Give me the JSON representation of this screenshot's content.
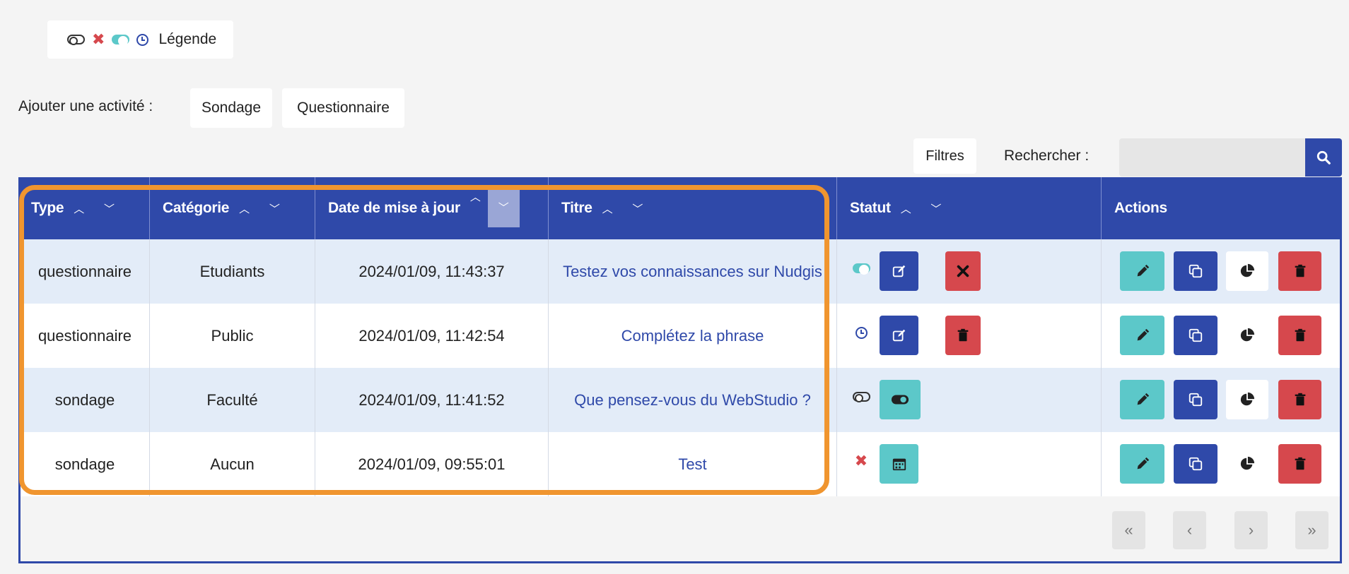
{
  "legend": {
    "label": "Légende"
  },
  "add_activity": {
    "label": "Ajouter une activité :",
    "buttons": [
      "Sondage",
      "Questionnaire"
    ]
  },
  "toolbar": {
    "filters_label": "Filtres",
    "search_label": "Rechercher :",
    "search_value": ""
  },
  "table": {
    "columns": [
      "Type",
      "Catégorie",
      "Date de mise à jour",
      "Titre",
      "Statut",
      "Actions"
    ],
    "rows": [
      {
        "type": "questionnaire",
        "categorie": "Etudiants",
        "date": "2024/01/09, 11:43:37",
        "titre": "Testez vos connaissances sur Nudgis",
        "statut_icon": "toggle-on-icon"
      },
      {
        "type": "questionnaire",
        "categorie": "Public",
        "date": "2024/01/09, 11:42:54",
        "titre": "Complétez la phrase",
        "statut_icon": "clock-icon"
      },
      {
        "type": "sondage",
        "categorie": "Faculté",
        "date": "2024/01/09, 11:41:52",
        "titre": "Que pensez-vous du WebStudio ?",
        "statut_icon": "toggle-off-icon"
      },
      {
        "type": "sondage",
        "categorie": "Aucun",
        "date": "2024/01/09, 09:55:01",
        "titre": "Test",
        "statut_icon": "x-icon"
      }
    ]
  },
  "pagination": [
    "«",
    "‹",
    "›",
    "»"
  ],
  "colors": {
    "primary": "#2f49a9",
    "danger": "#d6484d",
    "teal": "#5cc8c9",
    "highlight": "#f0952f"
  }
}
